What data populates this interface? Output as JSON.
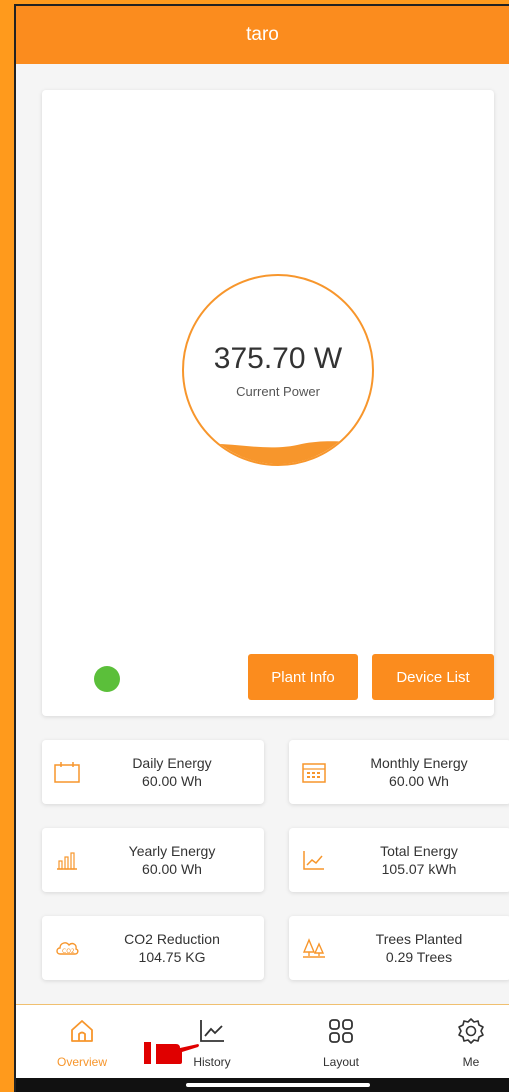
{
  "header": {
    "title": "taro"
  },
  "power": {
    "value": "375.70 W",
    "label": "Current Power"
  },
  "buttons": {
    "plant_info": "Plant Info",
    "device_list": "Device List"
  },
  "stats": {
    "daily": {
      "title": "Daily Energy",
      "value": "60.00 Wh"
    },
    "monthly": {
      "title": "Monthly Energy",
      "value": "60.00 Wh"
    },
    "yearly": {
      "title": "Yearly Energy",
      "value": "60.00 Wh"
    },
    "total": {
      "title": "Total Energy",
      "value": "105.07 kWh"
    },
    "co2": {
      "title": "CO2 Reduction",
      "value": "104.75 KG"
    },
    "trees": {
      "title": "Trees Planted",
      "value": "0.29 Trees"
    }
  },
  "nav": {
    "overview": "Overview",
    "history": "History",
    "layout": "Layout",
    "me": "Me"
  },
  "colors": {
    "accent": "#fb8c1e",
    "status_online": "#5bbf3a"
  }
}
